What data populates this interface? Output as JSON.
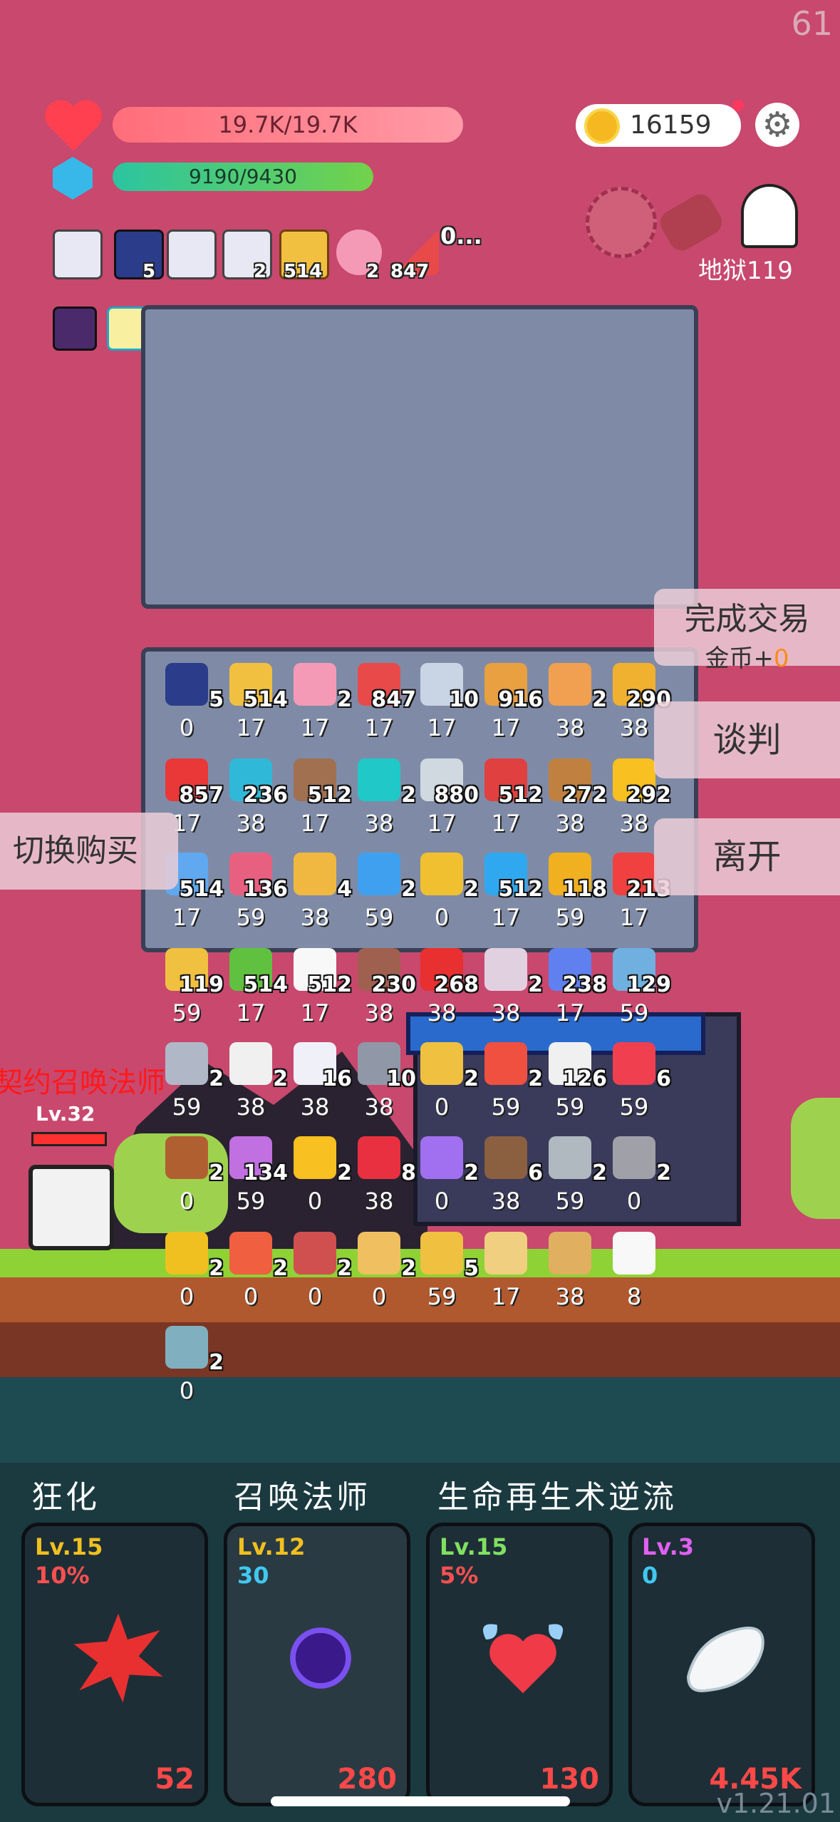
{
  "fps": "61",
  "hp": "19.7K/19.7K",
  "mp": "9190/9430",
  "gold": "16159",
  "stage": "地狱119",
  "buffs": [
    {
      "icon": "scroll-icon",
      "count": ""
    },
    {
      "icon": "bible-icon",
      "count": "5"
    },
    {
      "icon": "scroll-icon",
      "count": ""
    },
    {
      "icon": "scroll-icon",
      "count": "2"
    },
    {
      "icon": "beer-icon",
      "count": "514"
    },
    {
      "icon": "sundae-icon",
      "count": "2"
    },
    {
      "icon": "watermelon-icon",
      "count": "847"
    }
  ],
  "buffs_more": "0...",
  "buttons": {
    "complete_trade": "完成交易",
    "gold_gain_label": "金币+",
    "gold_gain_value": "0",
    "negotiate": "谈判",
    "leave": "离开",
    "switch_buy": "切换购买"
  },
  "hero": {
    "level": "Lv.32",
    "name_overlay": "契约召唤法师"
  },
  "items": [
    {
      "icon": "bible-icon",
      "color": "#2a3c8a",
      "count": "5",
      "price": "0"
    },
    {
      "icon": "beer-icon",
      "color": "#f2c040",
      "count": "514",
      "price": "17"
    },
    {
      "icon": "sundae-icon",
      "color": "#f59ab6",
      "count": "2",
      "price": "17"
    },
    {
      "icon": "watermelon-icon",
      "color": "#e84a4a",
      "count": "847",
      "price": "17"
    },
    {
      "icon": "dagger-icon",
      "color": "#c9d4e4",
      "count": "10",
      "price": "17"
    },
    {
      "icon": "book-icon",
      "color": "#e8a040",
      "count": "916",
      "price": "17"
    },
    {
      "icon": "briefcase-icon",
      "color": "#f0a050",
      "count": "2",
      "price": "38"
    },
    {
      "icon": "pineapple-icon",
      "color": "#f0b030",
      "count": "290",
      "price": "38"
    },
    {
      "icon": "apple-icon",
      "color": "#e83838",
      "count": "857",
      "price": "17"
    },
    {
      "icon": "wand-icon",
      "color": "#30b8d8",
      "count": "236",
      "price": "38"
    },
    {
      "icon": "shield-icon",
      "color": "#a07050",
      "count": "512",
      "price": "17"
    },
    {
      "icon": "spiral-icon",
      "color": "#20c8c8",
      "count": "2",
      "price": "38"
    },
    {
      "icon": "sword-icon",
      "color": "#d0d8e0",
      "count": "880",
      "price": "17"
    },
    {
      "icon": "thermometer-icon",
      "color": "#e04040",
      "count": "512",
      "price": "17"
    },
    {
      "icon": "crossbow-icon",
      "color": "#c08040",
      "count": "272",
      "price": "38"
    },
    {
      "icon": "sunflower-icon",
      "color": "#f8c020",
      "count": "292",
      "price": "38"
    },
    {
      "icon": "potion-icon",
      "color": "#60a8f0",
      "count": "514",
      "price": "17"
    },
    {
      "icon": "jar-icon",
      "color": "#e86080",
      "count": "136",
      "price": "59"
    },
    {
      "icon": "scroll-icon",
      "color": "#f0b840",
      "count": "4",
      "price": "38"
    },
    {
      "icon": "star-card-icon",
      "color": "#40a0f0",
      "count": "2",
      "price": "59"
    },
    {
      "icon": "tools-icon",
      "color": "#f0c030",
      "count": "2",
      "price": "0"
    },
    {
      "icon": "chat-bubble-icon",
      "color": "#30a8f0",
      "count": "512",
      "price": "17"
    },
    {
      "icon": "melon-icon",
      "color": "#f0b020",
      "count": "118",
      "price": "59"
    },
    {
      "icon": "pill-icon",
      "color": "#f04040",
      "count": "213",
      "price": "17"
    },
    {
      "icon": "arrows-icon",
      "color": "#f0c040",
      "count": "119",
      "price": "59"
    },
    {
      "icon": "flask-icon",
      "color": "#60c040",
      "count": "514",
      "price": "17"
    },
    {
      "icon": "egg-icon",
      "color": "#f8f8f8",
      "count": "512",
      "price": "17"
    },
    {
      "icon": "helmet-icon",
      "color": "#a06050",
      "count": "230",
      "price": "38"
    },
    {
      "icon": "red-card-icon",
      "color": "#e83030",
      "count": "268",
      "price": "38"
    },
    {
      "icon": "molecule-icon",
      "color": "#e0d0e0",
      "count": "2",
      "price": "38"
    },
    {
      "icon": "capsule-icon",
      "color": "#6080f0",
      "count": "238",
      "price": "17"
    },
    {
      "icon": "cloak-icon",
      "color": "#70b0e0",
      "count": "129",
      "price": "59"
    },
    {
      "icon": "compass-icon",
      "color": "#b0b8c8",
      "count": "2",
      "price": "59"
    },
    {
      "icon": "cards-icon",
      "color": "#f0f0f0",
      "count": "2",
      "price": "38"
    },
    {
      "icon": "envelope-icon",
      "color": "#f0f0f8",
      "count": "16",
      "price": "38"
    },
    {
      "icon": "axe-icon",
      "color": "#9098a8",
      "count": "10",
      "price": "38"
    },
    {
      "icon": "portrait-icon",
      "color": "#f0c040",
      "count": "2",
      "price": "0"
    },
    {
      "icon": "heat-icon",
      "color": "#f05040",
      "count": "2",
      "price": "59"
    },
    {
      "icon": "flag-icon",
      "color": "#f0f0f0",
      "count": "126",
      "price": "59"
    },
    {
      "icon": "heart-icon",
      "color": "#f04050",
      "count": "6",
      "price": "59"
    },
    {
      "icon": "drumstick-icon",
      "color": "#b06030",
      "count": "2",
      "price": "0"
    },
    {
      "icon": "flower-icon",
      "color": "#c070e0",
      "count": "134",
      "price": "59"
    },
    {
      "icon": "sun-icon",
      "color": "#f8c020",
      "count": "2",
      "price": "0"
    },
    {
      "icon": "strawberry-icon",
      "color": "#e83040",
      "count": "8",
      "price": "38"
    },
    {
      "icon": "magic-hammer-icon",
      "color": "#a070f0",
      "count": "2",
      "price": "0"
    },
    {
      "icon": "coconut-icon",
      "color": "#8a6040",
      "count": "6",
      "price": "38"
    },
    {
      "icon": "spiked-ball-icon",
      "color": "#b0b8c0",
      "count": "2",
      "price": "59"
    },
    {
      "icon": "tombstone-icon",
      "color": "#a0a0a8",
      "count": "2",
      "price": "0"
    },
    {
      "icon": "ring-icon",
      "color": "#f0c020",
      "count": "2",
      "price": "0"
    },
    {
      "icon": "crown-icon",
      "color": "#f06040",
      "count": "2",
      "price": "0"
    },
    {
      "icon": "hook-icon",
      "color": "#d05050",
      "count": "2",
      "price": "0"
    },
    {
      "icon": "note-icon",
      "color": "#f0c060",
      "count": "2",
      "price": "0"
    },
    {
      "icon": "mystery-scroll-icon",
      "color": "#f0c040",
      "count": "5",
      "price": "59"
    },
    {
      "icon": "map-icon",
      "color": "#f0d080",
      "count": "",
      "price": "17"
    },
    {
      "icon": "treasure-map-icon",
      "color": "#e0b060",
      "count": "",
      "price": "38"
    },
    {
      "icon": "dice-icon",
      "color": "#f8f8f8",
      "count": "",
      "price": "8"
    },
    {
      "icon": "ghost-branch-icon",
      "color": "#80b0c0",
      "count": "2",
      "price": "0"
    }
  ],
  "skill_names": [
    "狂化",
    "召唤法师",
    "生命再生术逆流"
  ],
  "skills": [
    {
      "level": "Lv.15",
      "level_color": "#f0c020",
      "value": "10%",
      "value_color": "#ff5050",
      "cost": "52",
      "icon": "burst-icon"
    },
    {
      "level": "Lv.12",
      "level_color": "#f0c020",
      "value": "30",
      "value_color": "#40c8f0",
      "cost": "280",
      "icon": "dark-orb-icon"
    },
    {
      "level": "Lv.15",
      "level_color": "#80e060",
      "value": "5%",
      "value_color": "#ff5050",
      "cost": "130",
      "icon": "winged-heart-icon"
    },
    {
      "level": "Lv.3",
      "level_color": "#e060f0",
      "value": "0",
      "value_color": "#40c8f0",
      "cost": "4.45K",
      "icon": "wing-icon"
    }
  ],
  "version": "v1.21.01"
}
